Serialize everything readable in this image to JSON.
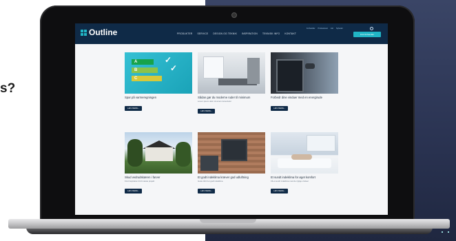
{
  "side_text": "s?",
  "site": {
    "logo": "Outline",
    "nav": [
      "PRODUKTER",
      "SERVICE",
      "DESIGN OG TEKNIK",
      "INSPIRATION",
      "TEKNISK INFO",
      "KONTAKT"
    ],
    "top_links": [
      "Forhandler",
      "Professionel",
      "Job",
      "Nyheder"
    ],
    "cta": "Find forhandler",
    "cards": [
      {
        "title": "Spar på varmeregningen",
        "sub": "",
        "button": "LÆS MERE"
      },
      {
        "title": "Sådan gør du moderne ruder til minimum",
        "sub": "Lorem ipsum dolor sit amet consectetur",
        "button": "LÆS MERE"
      },
      {
        "title": "Forbedr dine vinduer med en energirude",
        "sub": "",
        "button": "LÆS MERE"
      },
      {
        "title": "Skud vedrudskæren i farver",
        "sub": "Find inspiration til dit næste projekt",
        "button": "LÆS MERE"
      },
      {
        "title": "Et godt indeklima kræver god udluftning",
        "sub": "Gode råd til et godt indeklima",
        "button": "LÆS MERE"
      },
      {
        "title": "Et sundt indeklima for øget komfort",
        "sub": "Få et sundt indeklima med de rigtige vinduer",
        "button": "LÆS MERE"
      }
    ],
    "energy_labels": [
      "A",
      "B",
      "C"
    ]
  },
  "colors": {
    "header": "#0f2a47",
    "accent": "#21b5c5",
    "background_right": "#2b3453"
  }
}
